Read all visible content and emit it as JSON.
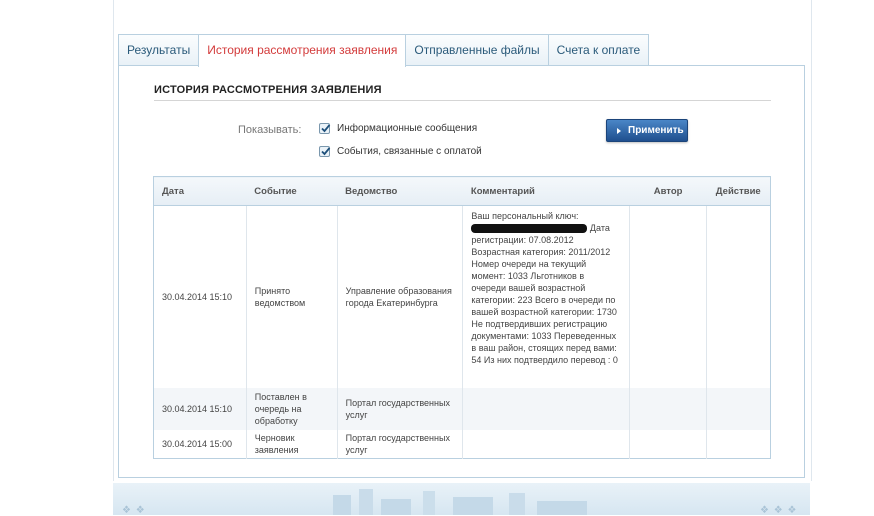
{
  "tabs": [
    {
      "label": "Результаты",
      "active": false
    },
    {
      "label": "История рассмотрения заявления",
      "active": true
    },
    {
      "label": "Отправленные файлы",
      "active": false
    },
    {
      "label": "Счета к оплате",
      "active": false
    }
  ],
  "section": {
    "title": "ИСТОРИЯ РАССМОТРЕНИЯ ЗАЯВЛЕНИЯ"
  },
  "filters": {
    "show_label": "Показывать:",
    "options": [
      {
        "label": "Информационные сообщения",
        "checked": true
      },
      {
        "label": "События, связанные с оплатой",
        "checked": true
      }
    ],
    "apply_label": "Применить"
  },
  "table": {
    "columns": [
      "Дата",
      "Событие",
      "Ведомство",
      "Комментарий",
      "Автор",
      "Действие"
    ],
    "rows": [
      {
        "date": "30.04.2014 15:10",
        "event": "Принято ведомством",
        "agency": "Управление образования города Екатеринбурга",
        "comment_prefix": "Ваш персональный ключ:",
        "comment_rest": "Дата регистрации: 07.08.2012 Возрастная категория: 2011/2012 Номер очереди на текущий момент: 1033 Льготников в очереди вашей возрастной категории: 223 Всего в очереди по вашей возрастной категории: 1730 Не подтвердивших регистрацию документами: 1033 Переведенных в ваш район, стоящих перед вами: 54 Из них подтвердило перевод : 0",
        "author": "",
        "action": ""
      },
      {
        "date": "30.04.2014 15:10",
        "event": "Поставлен в очередь на обработку",
        "agency": "Портал государственных услуг",
        "comment_prefix": "",
        "comment_rest": "",
        "author": "",
        "action": ""
      },
      {
        "date": "30.04.2014 15:00",
        "event": "Черновик заявления",
        "agency": "Портал государственных услуг",
        "comment_prefix": "",
        "comment_rest": "",
        "author": "",
        "action": ""
      }
    ]
  },
  "colors": {
    "active_tab": "#d33b3b",
    "button": "#2a5f9e",
    "border": "#b9d0e0"
  }
}
